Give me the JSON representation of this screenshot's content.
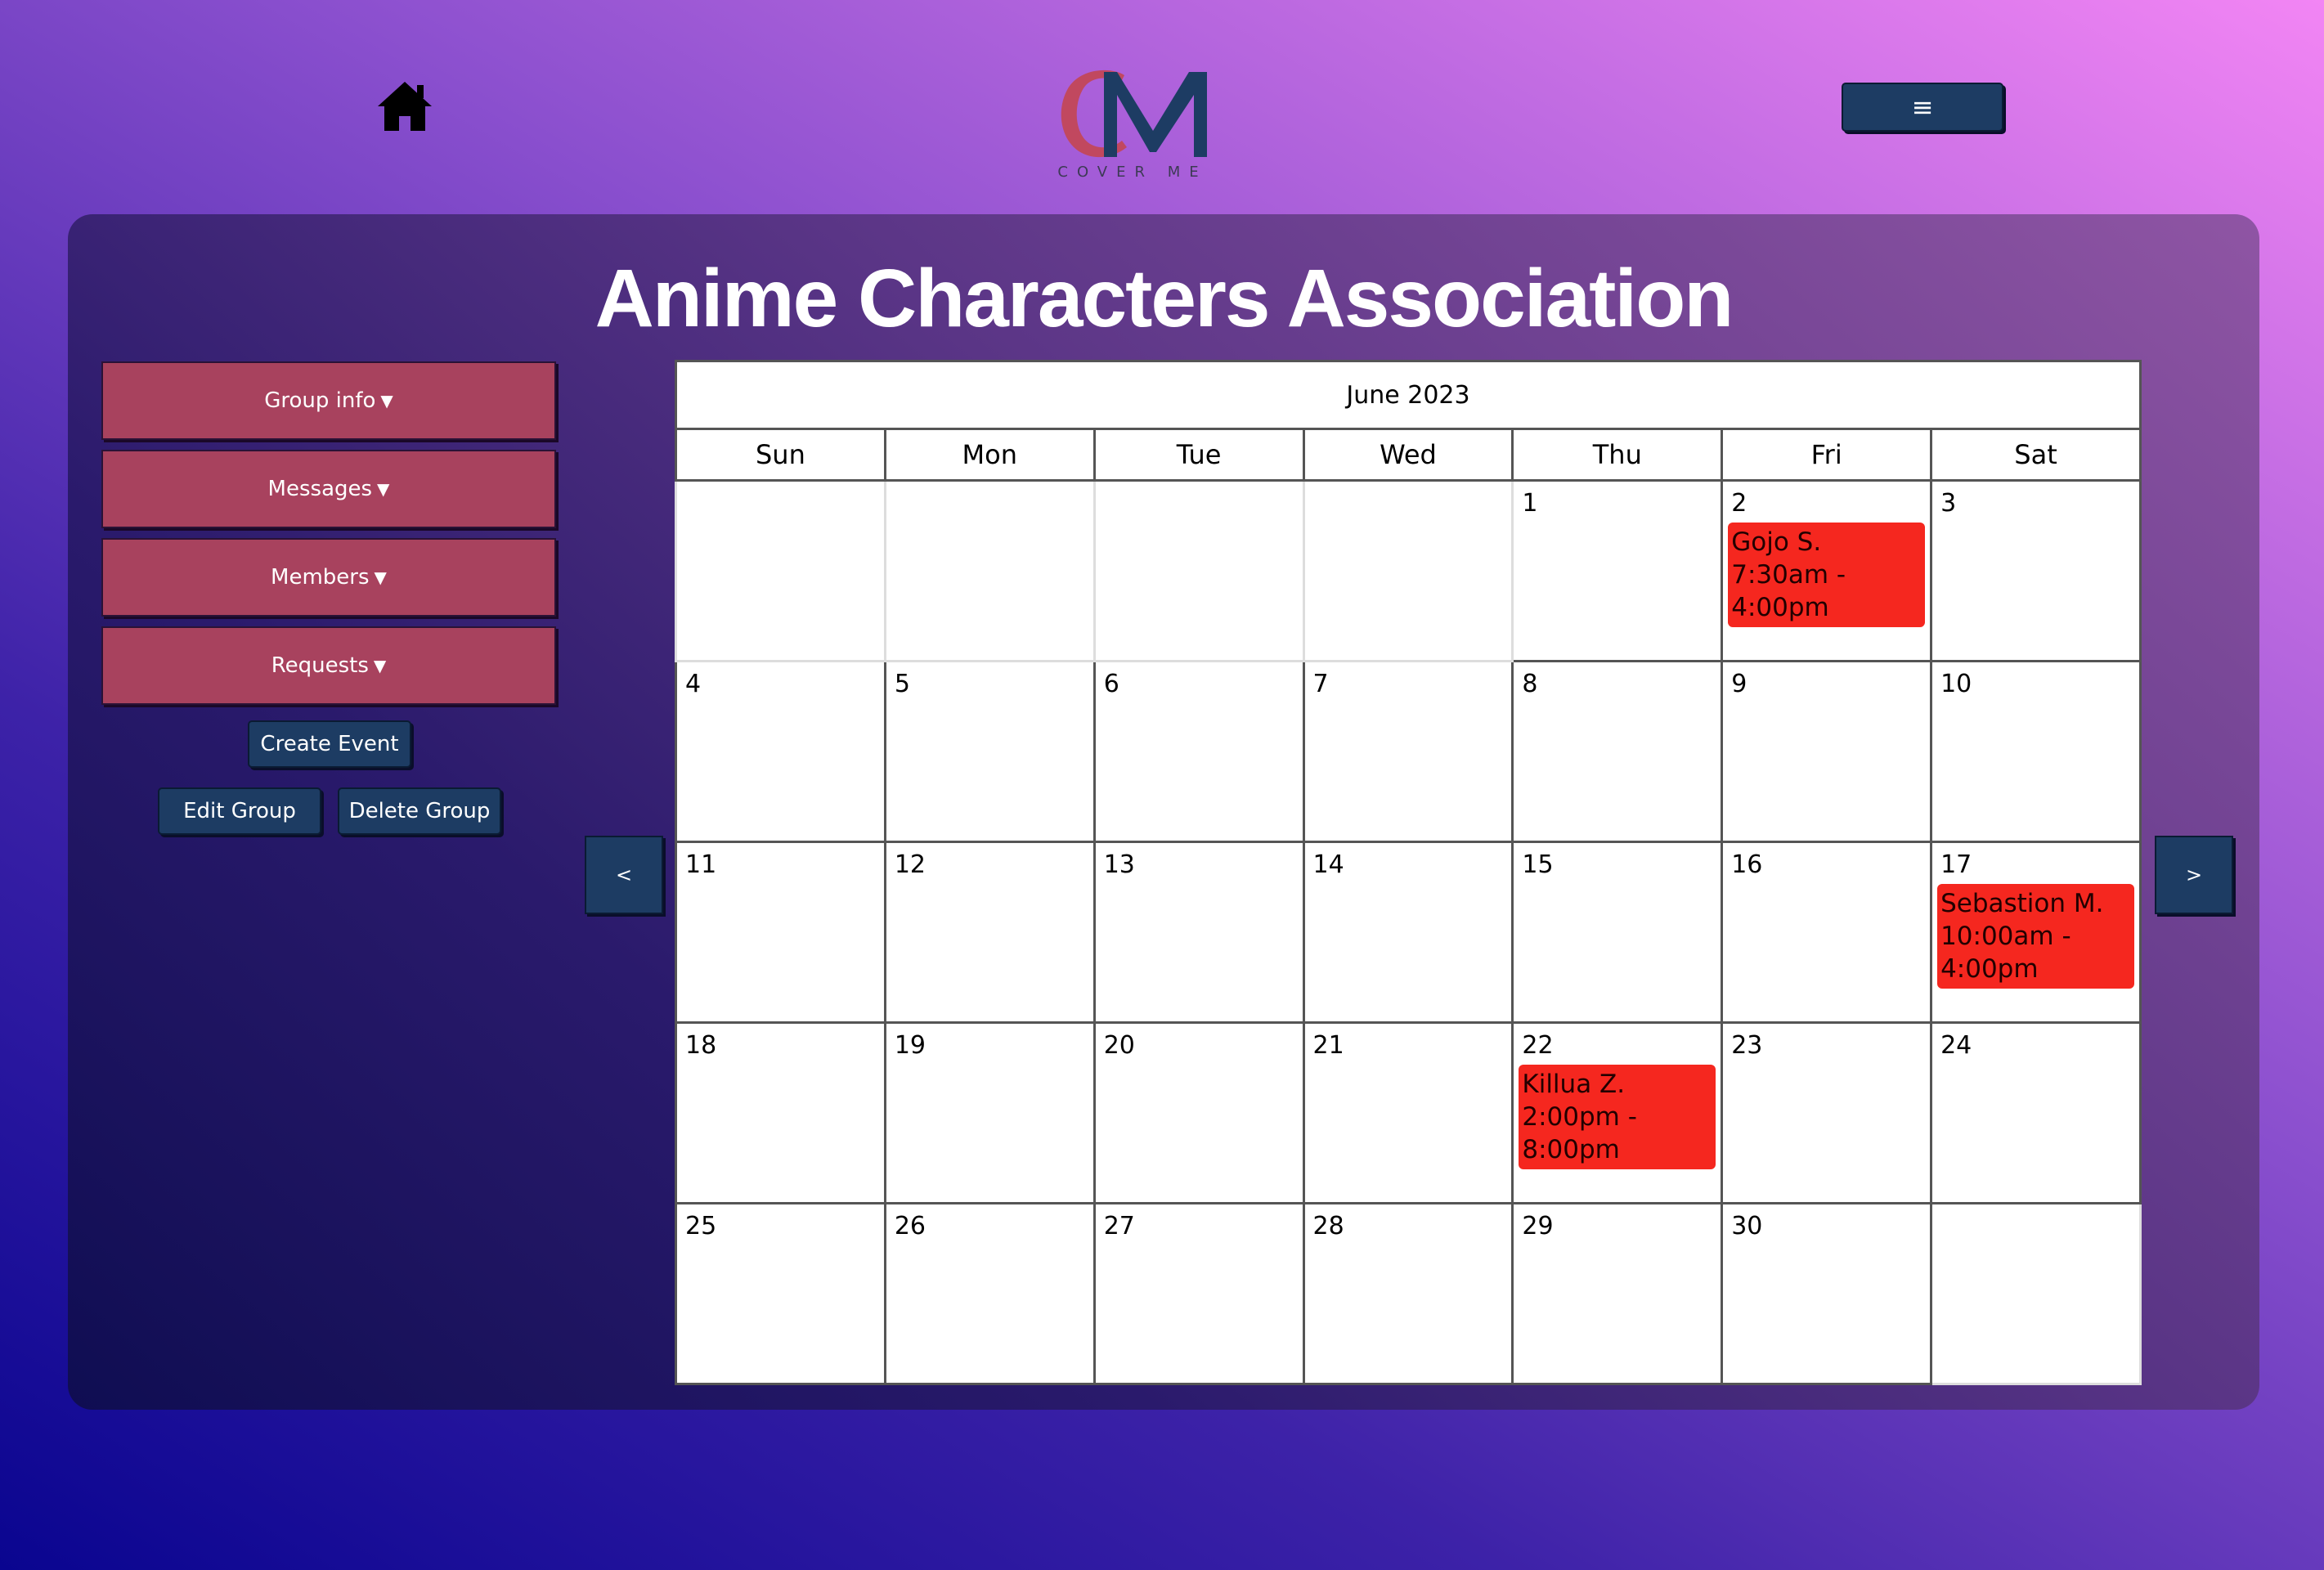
{
  "logo": {
    "letters": "CM",
    "tagline": "COVER ME"
  },
  "header": {
    "menu_icon": "≡"
  },
  "group": {
    "title": "Anime Characters Association"
  },
  "sidebar": {
    "dropdowns": [
      {
        "label": "Group info"
      },
      {
        "label": "Messages"
      },
      {
        "label": "Members"
      },
      {
        "label": "Requests"
      }
    ],
    "create_event": "Create Event",
    "edit_group": "Edit Group",
    "delete_group": "Delete Group"
  },
  "calendar": {
    "month": "June 2023",
    "prev": "<",
    "next": ">",
    "days_of_week": [
      "Sun",
      "Mon",
      "Tue",
      "Wed",
      "Thu",
      "Fri",
      "Sat"
    ],
    "weeks": [
      [
        "",
        "",
        "",
        "",
        "1",
        "2",
        "3"
      ],
      [
        "4",
        "5",
        "6",
        "7",
        "8",
        "9",
        "10"
      ],
      [
        "11",
        "12",
        "13",
        "14",
        "15",
        "16",
        "17"
      ],
      [
        "18",
        "19",
        "20",
        "21",
        "22",
        "23",
        "24"
      ],
      [
        "25",
        "26",
        "27",
        "28",
        "29",
        "30",
        ""
      ]
    ],
    "events": [
      {
        "day": "2",
        "name": "Gojo S.",
        "time": "7:30am - 4:00pm"
      },
      {
        "day": "17",
        "name": "Sebastion M.",
        "time": "10:00am - 4:00pm"
      },
      {
        "day": "22",
        "name": "Killua Z.",
        "time": "2:00pm - 8:00pm"
      }
    ]
  },
  "colors": {
    "accent_button": "#1d3c63",
    "dropdown_button": "#a8425e",
    "event": "#f5271f"
  }
}
